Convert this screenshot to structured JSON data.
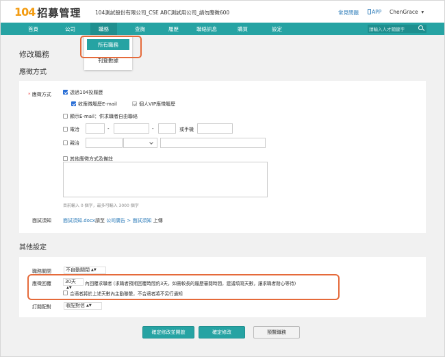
{
  "header": {
    "logo_number": "104",
    "logo_text": "招募管理",
    "company": "104測試股份有限公司_CSE ABC測試用公司_請勿應徵600",
    "faq": "常見問題",
    "app": "APP",
    "user": "ChenGrace",
    "user_caret": "▾"
  },
  "nav": {
    "items": [
      "首頁",
      "公司",
      "職務",
      "查詢",
      "履歷",
      "聯絡訊息",
      "購買",
      "設定"
    ],
    "search_placeholder": "請輸入人才關鍵字"
  },
  "dropdown": {
    "items": [
      "所有職務",
      "刊登數據"
    ]
  },
  "page": {
    "title": "修改職務",
    "section1": "應徵方式",
    "section2": "其他設定"
  },
  "apply": {
    "label_required": "*",
    "label": "應徵方式",
    "via_104": "透過104投履歷",
    "receive_email": "收應徵履歷E-mail",
    "vip": "個人VIP應徵履歷",
    "show_email": "顯示E-mail：供求職者自由聯絡",
    "phone_label": "電洽",
    "phone_dash1": "-",
    "phone_dash2": "-",
    "mobile_label": "或手機",
    "visit_label": "親洽",
    "other": "其他應徵方式及備註",
    "char_note": "目前輸入 0 個字，最多可輸入 3000 個字",
    "interview_label": "面試須知",
    "interview_file": "面試須知.docx",
    "interview_mid": "請至",
    "interview_link1": "公司廣告",
    "interview_arrow": ">",
    "interview_link2": "面試須知",
    "interview_end": "上傳"
  },
  "other": {
    "close_label": "職務關閉",
    "close_value": "不自動關閉",
    "reply_label": "應徵回覆",
    "reply_days": "30天",
    "reply_desc": "內回覆求職者 (求職者預期回覆時間約3天，如需較長的履歷審閱時間，建議填寫天數，讓求職者耐心等待)",
    "reply_check": "合適者將於上述天數內主動聯繫，不合適者將不另行通知",
    "match_label": "訂閱配對",
    "match_value": "收配對信"
  },
  "buttons": {
    "save_open": "確定修改並開啟",
    "save": "確定修改",
    "preview": "預覽職務"
  }
}
